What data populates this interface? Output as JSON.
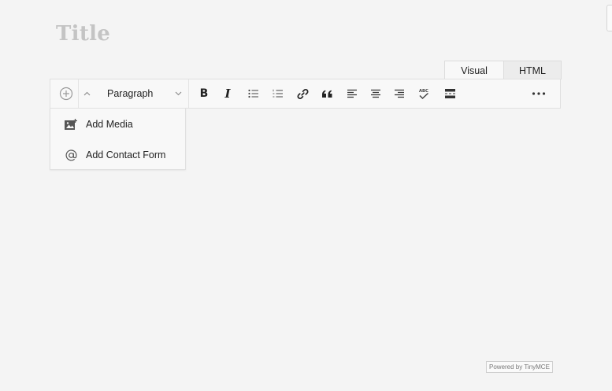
{
  "editor": {
    "title_placeholder": "Title",
    "tabs": [
      {
        "label": "Visual",
        "active": true
      },
      {
        "label": "HTML",
        "active": false
      }
    ],
    "toolbar": {
      "format_select": "Paragraph",
      "bold": "B",
      "italic": "I",
      "more": "•••",
      "icons": [
        "add-block-icon",
        "collapse-chevron-icon",
        "paragraph-chevron-icon",
        "bold-icon",
        "italic-icon",
        "bullet-list-icon",
        "numbered-list-icon",
        "link-icon",
        "blockquote-icon",
        "align-left-icon",
        "align-center-icon",
        "align-right-icon",
        "spellcheck-icon",
        "read-more-icon",
        "more-options-icon"
      ]
    },
    "insert_menu": {
      "items": [
        {
          "label": "Add Media",
          "icon": "add-media-icon"
        },
        {
          "label": "Add Contact Form",
          "icon": "at-sign-icon"
        }
      ]
    },
    "footer": {
      "powered_by": "Powered by TinyMCE"
    }
  },
  "colors": {
    "background": "#f4f4f4",
    "toolbar": "#f8f8f8",
    "border": "#e0e0e0",
    "title": "#c4c4c4",
    "icon": "#2b2b2b"
  }
}
